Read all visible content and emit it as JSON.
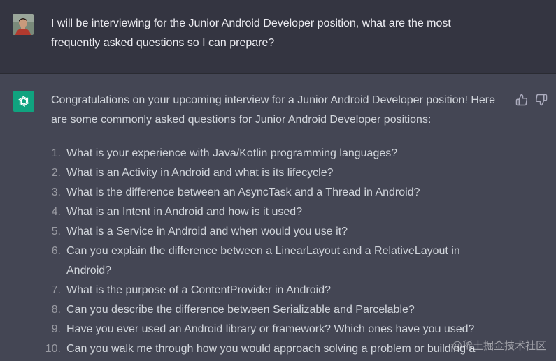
{
  "user_message": {
    "text": "I will be interviewing for the Junior Android Developer position, what are the most frequently asked questions so I can prepare?"
  },
  "assistant_message": {
    "intro": "Congratulations on your upcoming interview for a Junior Android Developer position! Here are some commonly asked questions for Junior Android Developer positions:",
    "questions": [
      {
        "num": "1.",
        "text": "What is your experience with Java/Kotlin programming languages?"
      },
      {
        "num": "2.",
        "text": "What is an Activity in Android and what is its lifecycle?"
      },
      {
        "num": "3.",
        "text": "What is the difference between an AsyncTask and a Thread in Android?"
      },
      {
        "num": "4.",
        "text": "What is an Intent in Android and how is it used?"
      },
      {
        "num": "5.",
        "text": "What is a Service in Android and when would you use it?"
      },
      {
        "num": "6.",
        "text": "Can you explain the difference between a LinearLayout and a RelativeLayout in Android?"
      },
      {
        "num": "7.",
        "text": "What is the purpose of a ContentProvider in Android?"
      },
      {
        "num": "8.",
        "text": "Can you describe the difference between Serializable and Parcelable?"
      },
      {
        "num": "9.",
        "text": "Have you ever used an Android library or framework? Which ones have you used?"
      },
      {
        "num": "10.",
        "text": "Can you walk me through how you would approach solving a problem or building a"
      }
    ]
  },
  "icons": {
    "avatar": "user-avatar",
    "logo": "openai-logo-icon",
    "like": "thumbs-up-icon",
    "dislike": "thumbs-down-icon"
  },
  "colors": {
    "user_bg": "#343541",
    "assistant_bg": "#444654",
    "brand": "#10a37f"
  },
  "watermark": "@稀土掘金技术社区"
}
